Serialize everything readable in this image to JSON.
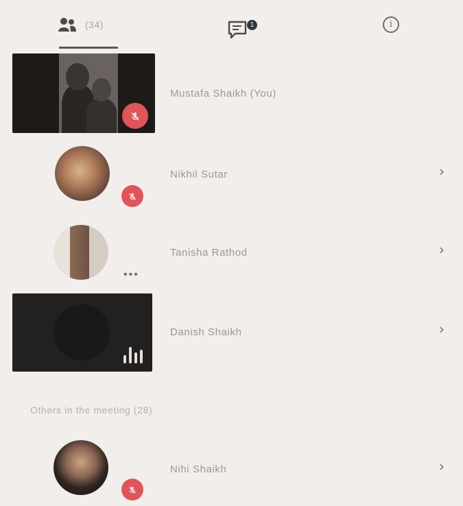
{
  "tabs": {
    "people": {
      "count": "(34)",
      "icon": "people-icon"
    },
    "chat": {
      "badge": "1",
      "icon": "chat-icon"
    },
    "info": {
      "glyph": "i",
      "icon": "info-icon"
    }
  },
  "participants": [
    {
      "name": "Mustafa Shaikh (You)",
      "muted": true
    },
    {
      "name": "Nikhil Sutar",
      "muted": true,
      "chevron": "›"
    },
    {
      "name": "Tanisha Rathod",
      "status": "•••",
      "chevron": "›"
    },
    {
      "name": "Danish Shaikh",
      "speaking": true,
      "chevron": "›"
    }
  ],
  "others": {
    "heading": "Others in the meeting (28)",
    "items": [
      {
        "name": "Nihi Shaikh",
        "muted": true,
        "chevron": "›"
      }
    ]
  },
  "colors": {
    "background": "#f1eeec",
    "mute_badge": "#e0555a",
    "chat_badge": "#2f3a3d"
  }
}
